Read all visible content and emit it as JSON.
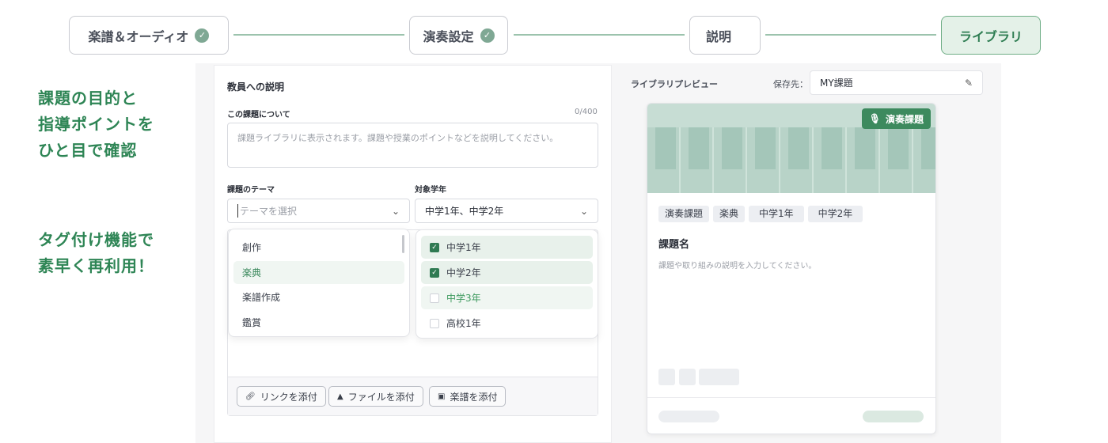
{
  "stepper": {
    "steps": [
      {
        "label": "楽譜＆オーディオ",
        "done": true
      },
      {
        "label": "演奏設定",
        "done": true
      },
      {
        "label": "説明",
        "done": false
      },
      {
        "label": "ライブラリ",
        "done": false,
        "active": true
      }
    ]
  },
  "promo": {
    "lines1": [
      "課題の目的と",
      "指導ポイントを",
      "ひと目で確認"
    ],
    "lines2": [
      "タグ付け機能で",
      "素早く再利用！"
    ]
  },
  "form": {
    "section_title": "教員への説明",
    "about_label": "この課題について",
    "about_counter": "0/400",
    "about_placeholder": "課題ライブラリに表示されます。課題や授業のポイントなどを説明してください。",
    "theme_label": "課題のテーマ",
    "theme_placeholder": "テーマを選択",
    "grade_label": "対象学年",
    "grade_value": "中学1年、中学2年",
    "theme_options": [
      "創作",
      "楽典",
      "楽譜作成",
      "鑑賞"
    ],
    "grade_options": [
      {
        "label": "中学1年",
        "checked": true
      },
      {
        "label": "中学2年",
        "checked": true
      },
      {
        "label": "中学3年",
        "checked": false
      },
      {
        "label": "高校1年",
        "checked": false
      }
    ],
    "attach": {
      "link": "リンクを添付",
      "file": "ファイルを添付",
      "score": "楽譜を添付"
    }
  },
  "preview": {
    "title": "ライブラリプレビュー",
    "save_label": "保存先：",
    "save_value": "MY課題",
    "badge": "演奏課題",
    "tags": [
      "演奏課題",
      "楽典",
      "中学1年",
      "中学2年"
    ],
    "card_title": "課題名",
    "card_desc": "課題や取り組みの説明を入力してください。"
  },
  "colors": {
    "accent": "#2e8555",
    "badge": "#3d8a5e"
  }
}
